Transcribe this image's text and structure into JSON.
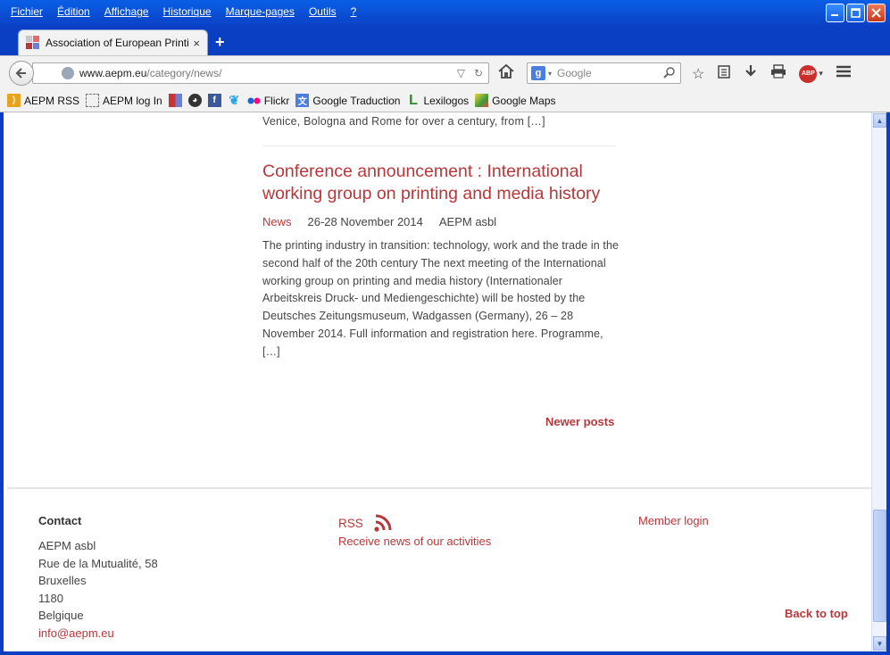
{
  "menubar": {
    "items": [
      "Fichier",
      "Édition",
      "Affichage",
      "Historique",
      "Marque-pages",
      "Outils",
      "?"
    ]
  },
  "tab": {
    "title": "Association of European Printi...",
    "close": "×",
    "new_tab": "+"
  },
  "urlbar": {
    "host": "www.aepm.eu",
    "path": "/category/news/"
  },
  "searchbar": {
    "engine_letter": "g",
    "placeholder": "Google"
  },
  "bookmarks": [
    {
      "label": "AEPM RSS",
      "icon": "rss-folder-icon",
      "color": "#e8a21b"
    },
    {
      "label": "AEPM log In",
      "icon": "page-icon",
      "color": "#ffffff"
    },
    {
      "label": "",
      "icon": "aepm-favicon-icon",
      "color": "#c33"
    },
    {
      "label": "",
      "icon": "penguin-icon",
      "color": "#333"
    },
    {
      "label": "",
      "icon": "facebook-icon",
      "color": "#3b5998"
    },
    {
      "label": "",
      "icon": "twitter-icon",
      "color": "#2aa3ef"
    },
    {
      "label": "Flickr",
      "icon": "flickr-icon",
      "color": "#ff0084"
    },
    {
      "label": "Google Traduction",
      "icon": "translate-icon",
      "color": "#4a7fe0"
    },
    {
      "label": "Lexilogos",
      "icon": "lexilogos-icon",
      "color": "#2a8a2a"
    },
    {
      "label": "Google Maps",
      "icon": "maps-icon",
      "color": "#3c9a3c"
    }
  ],
  "content": {
    "previous_excerpt": "Venice, Bologna and Rome for over a century, from […]",
    "post": {
      "title": "Conference announcement : International working group on printing and media history",
      "category": "News",
      "date": "26-28 November 2014",
      "author": "AEPM asbl",
      "excerpt": "The printing industry in transition: technology, work and the trade in the second half of the 20th century The next meeting of the International working group on printing and media history (Internationaler Arbeitskreis Druck- und Mediengeschichte) will be hosted by the Deutsches Zeitungsmuseum, Wadgassen (Germany), 26 – 28 November 2014. Full information and registration here. Programme, […]"
    },
    "newer_posts": "Newer posts"
  },
  "footer": {
    "contact_heading": "Contact",
    "contact_lines": [
      "AEPM asbl",
      "Rue de la Mutualité, 58",
      "Bruxelles",
      "1180",
      "Belgique"
    ],
    "email": "info@aepm.eu",
    "rss_label": "RSS",
    "rss_subtitle": "Receive news of our activities",
    "member_login": "Member login",
    "back_to_top": "Back to top"
  },
  "colors": {
    "accent": "#b8373a",
    "body_text": "#444444",
    "window_blue": "#0a3fc4"
  }
}
